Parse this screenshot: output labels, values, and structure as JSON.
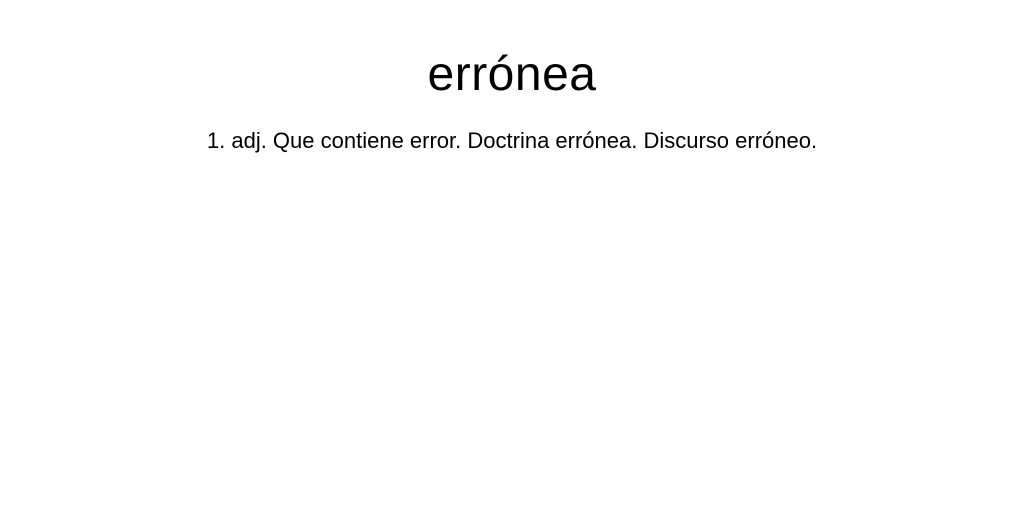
{
  "entry": {
    "headword": "errónea",
    "definition": "1. adj. Que contiene error. Doctrina errónea. Discurso erróneo."
  },
  "colors": {
    "background": "#ffffff",
    "text": "#000000"
  }
}
